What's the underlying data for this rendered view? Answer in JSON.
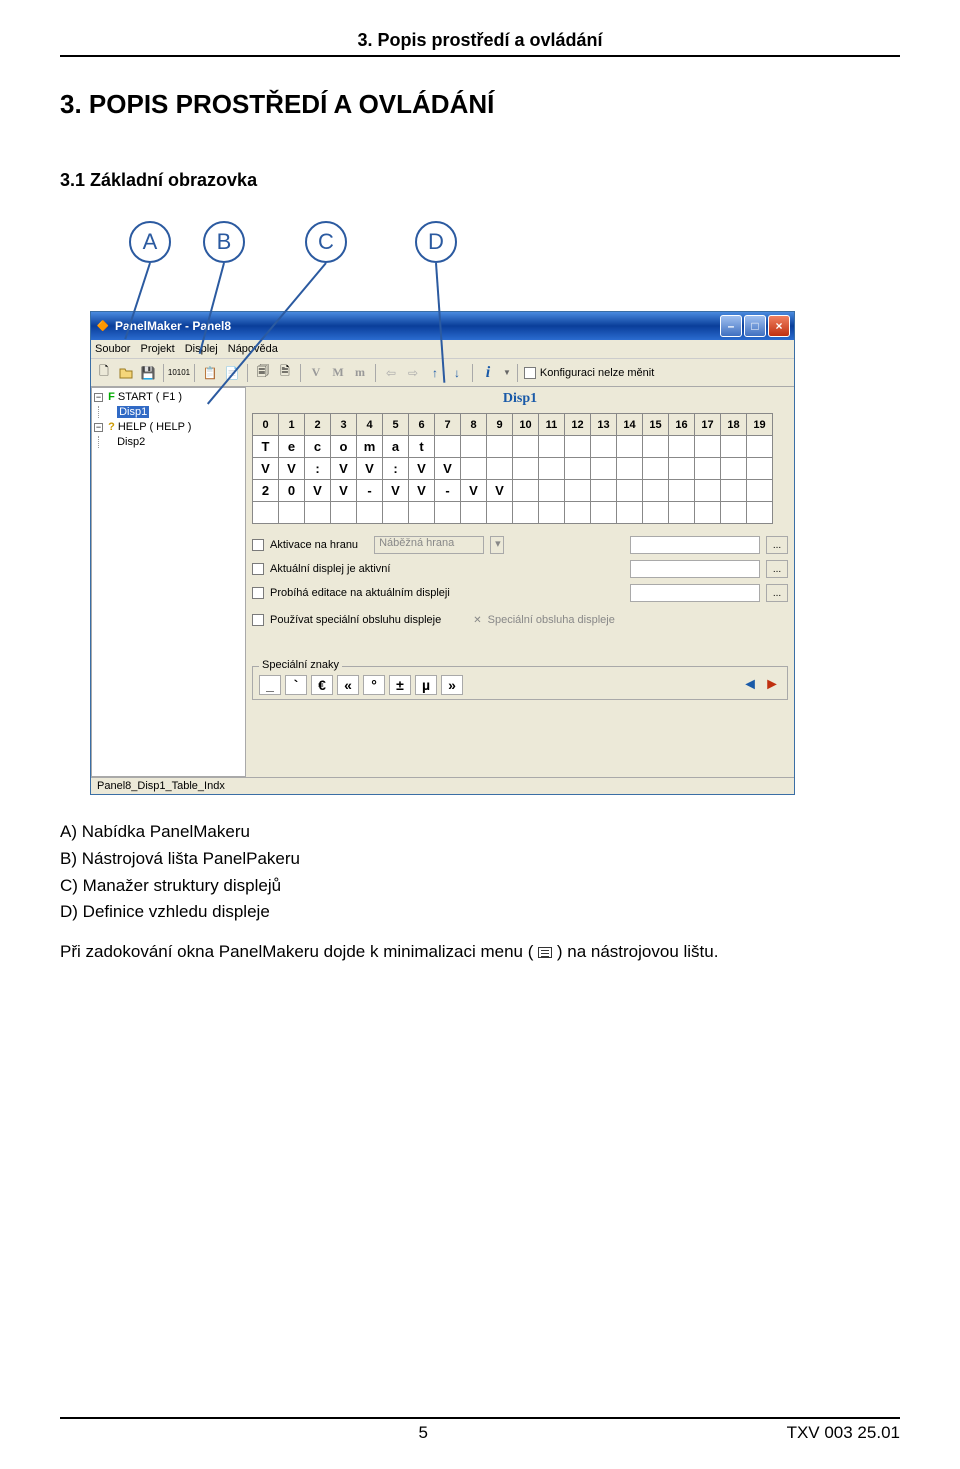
{
  "doc": {
    "header": "3. Popis prostředí a ovládání",
    "chapter": "3.   POPIS PROSTŘEDÍ A OVLÁDÁNÍ",
    "section": "3.1   Základní obrazovka",
    "callouts": [
      "A",
      "B",
      "C",
      "D"
    ],
    "body_lines": [
      "A) Nabídka PanelMakeru",
      "B) Nástrojová lišta PanelPakeru",
      "C) Manažer struktury displejů",
      "D) Definice vzhledu displeje"
    ],
    "dock_line_before": "Při zadokování okna PanelMakeru dojde k minimalizaci menu (",
    "dock_line_after": ") na nástrojovou lištu.",
    "footer_page": "5",
    "footer_doc": "TXV 003 25.01"
  },
  "app": {
    "title": "PanelMaker - Panel8",
    "menus": [
      "Soubor",
      "Projekt",
      "Displej",
      "Nápověda"
    ],
    "toolbar": {
      "V": "V",
      "M": "M",
      "m": "m",
      "config_lock": "Konfiguraci nelze měnit"
    },
    "tree": {
      "n0_label": "START ( F1 )",
      "n0_child": "Disp1",
      "n1_label": "HELP ( HELP )",
      "n1_child": "Disp2"
    },
    "disp_name": "Disp1",
    "grid_header": [
      "0",
      "1",
      "2",
      "3",
      "4",
      "5",
      "6",
      "7",
      "8",
      "9",
      "10",
      "11",
      "12",
      "13",
      "14",
      "15",
      "16",
      "17",
      "18",
      "19"
    ],
    "grid_rows": [
      [
        {
          "t": "T"
        },
        {
          "t": "e"
        },
        {
          "t": "c"
        },
        {
          "t": "o"
        },
        {
          "t": "m"
        },
        {
          "t": "a"
        },
        {
          "t": "t"
        },
        {
          "t": ""
        },
        {
          "t": ""
        },
        {
          "t": ""
        },
        {
          "t": ""
        },
        {
          "t": ""
        },
        {
          "t": ""
        },
        {
          "t": ""
        },
        {
          "t": ""
        },
        {
          "t": ""
        },
        {
          "t": ""
        },
        {
          "t": ""
        },
        {
          "t": ""
        },
        {
          "t": ""
        }
      ],
      [
        {
          "t": "V",
          "g": 1
        },
        {
          "t": "V",
          "g": 1
        },
        {
          "t": ":"
        },
        {
          "t": "V",
          "g": 1
        },
        {
          "t": "V",
          "g": 1
        },
        {
          "t": ":"
        },
        {
          "t": "V",
          "g": 1
        },
        {
          "t": "V",
          "g": 1
        },
        {
          "t": ""
        },
        {
          "t": ""
        },
        {
          "t": ""
        },
        {
          "t": ""
        },
        {
          "t": ""
        },
        {
          "t": ""
        },
        {
          "t": ""
        },
        {
          "t": ""
        },
        {
          "t": ""
        },
        {
          "t": ""
        },
        {
          "t": ""
        },
        {
          "t": ""
        }
      ],
      [
        {
          "t": "2"
        },
        {
          "t": "0"
        },
        {
          "t": "V",
          "g": 1
        },
        {
          "t": "V",
          "g": 1
        },
        {
          "t": "-"
        },
        {
          "t": "V",
          "g": 1
        },
        {
          "t": "V",
          "g": 1
        },
        {
          "t": "-"
        },
        {
          "t": "V",
          "g": 1
        },
        {
          "t": "V",
          "g": 1
        },
        {
          "t": ""
        },
        {
          "t": ""
        },
        {
          "t": ""
        },
        {
          "t": ""
        },
        {
          "t": ""
        },
        {
          "t": ""
        },
        {
          "t": ""
        },
        {
          "t": ""
        },
        {
          "t": ""
        },
        {
          "t": ""
        }
      ],
      [
        {
          "t": ""
        },
        {
          "t": ""
        },
        {
          "t": ""
        },
        {
          "t": ""
        },
        {
          "t": ""
        },
        {
          "t": ""
        },
        {
          "t": ""
        },
        {
          "t": ""
        },
        {
          "t": ""
        },
        {
          "t": ""
        },
        {
          "t": ""
        },
        {
          "t": ""
        },
        {
          "t": ""
        },
        {
          "t": ""
        },
        {
          "t": ""
        },
        {
          "t": ""
        },
        {
          "t": ""
        },
        {
          "t": ""
        },
        {
          "t": ""
        },
        {
          "t": ""
        }
      ]
    ],
    "form": {
      "chk1": "Aktivace na hranu",
      "edge_value": "Náběžná hrana",
      "chk2": "Aktuální displej je aktivní",
      "chk3": "Probíhá editace na aktuálním displeji",
      "chk4": "Používat speciální obsluhu displeje",
      "special_label": "Speciální obsluha displeje"
    },
    "specials_label": "Speciální znaky",
    "special_chars": [
      "_",
      "`",
      "€",
      "«",
      "°",
      "±",
      "µ",
      "»"
    ],
    "status": "Panel8_Disp1_Table_Indx"
  }
}
